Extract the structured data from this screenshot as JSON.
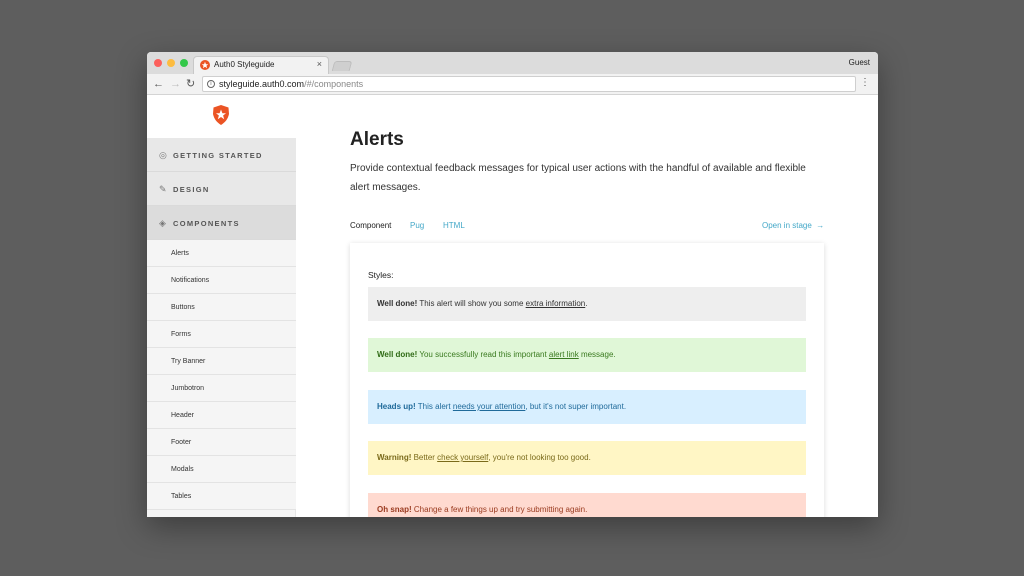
{
  "browser": {
    "tab_title": "Auth0 Styleguide",
    "tab_close": "×",
    "profile": "Guest",
    "url_host": "styleguide.auth0.com",
    "url_path": "/#/components",
    "back_icon": "←",
    "forward_icon": "→",
    "reload_icon": "↻",
    "menu_icon": "⋮",
    "info_icon": "i"
  },
  "sidebar": {
    "sections": [
      {
        "label": "GETTING STARTED",
        "icon": "◎",
        "icon_name": "target-icon"
      },
      {
        "label": "DESIGN",
        "icon": "✎",
        "icon_name": "pencil-icon"
      },
      {
        "label": "COMPONENTS",
        "icon": "◈",
        "icon_name": "layers-icon"
      }
    ],
    "items": [
      {
        "label": "Alerts"
      },
      {
        "label": "Notifications"
      },
      {
        "label": "Buttons"
      },
      {
        "label": "Forms"
      },
      {
        "label": "Try Banner"
      },
      {
        "label": "Jumbotron"
      },
      {
        "label": "Header"
      },
      {
        "label": "Footer"
      },
      {
        "label": "Modals"
      },
      {
        "label": "Tables"
      }
    ]
  },
  "main": {
    "title": "Alerts",
    "description": "Provide contextual feedback messages for typical user actions with the handful of available and flexible alert messages.",
    "tabs": [
      "Component",
      "Pug",
      "HTML"
    ],
    "open_stage": "Open in stage",
    "open_stage_arrow": "→",
    "styles_label": "Styles:",
    "alerts": {
      "default": {
        "strong": "Well done!",
        "pre": " This alert will show you some ",
        "link": "extra information",
        "post": "."
      },
      "success": {
        "strong": "Well done!",
        "pre": " You successfully read this important ",
        "link": "alert link",
        "post": " message."
      },
      "info": {
        "strong": "Heads up!",
        "pre": " This alert ",
        "link": "needs your attention",
        "post": ", but it's not super important."
      },
      "warning": {
        "strong": "Warning!",
        "pre": " Better ",
        "link": "check yourself",
        "post": ", you're not looking too good."
      },
      "danger": {
        "strong": "Oh snap!",
        "pre": " Change a few things up and try submitting again.",
        "link": "",
        "post": ""
      }
    }
  },
  "colors": {
    "brand": "#eb5424",
    "link": "#44a8c8"
  }
}
